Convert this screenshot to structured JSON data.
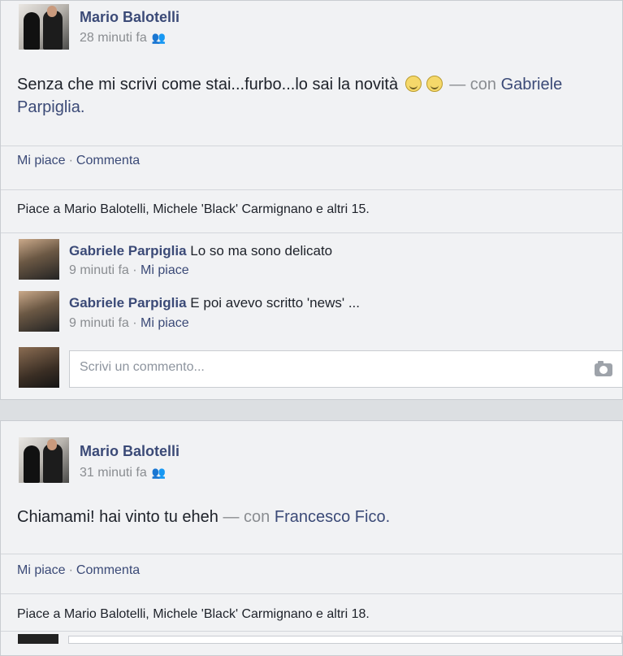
{
  "posts": [
    {
      "author": "Mario Balotelli",
      "time": "28 minuti fa",
      "text_main": "Senza che mi scrivi come stai...furbo...lo sai la novità",
      "text_sep": "— con",
      "tagged": "Gabriele",
      "tagged_cont": "Parpiglia.",
      "actions": {
        "like": "Mi piace",
        "comment": "Commenta"
      },
      "likes_summary": "Piace a Mario Balotelli, Michele 'Black' Carmignano e altri 15.",
      "comments": [
        {
          "author": "Gabriele Parpiglia",
          "text": "Lo so ma sono delicato",
          "time": "9 minuti fa",
          "like": "Mi piace"
        },
        {
          "author": "Gabriele Parpiglia",
          "text": "E poi avevo scritto 'news' ...",
          "time": "9 minuti fa",
          "like": "Mi piace"
        }
      ],
      "comment_placeholder": "Scrivi un commento..."
    },
    {
      "author": "Mario Balotelli",
      "time": "31 minuti fa",
      "text_main": "Chiamami! hai vinto tu eheh",
      "text_sep": "— con",
      "tagged": "Francesco Fico.",
      "actions": {
        "like": "Mi piace",
        "comment": "Commenta"
      },
      "likes_summary": "Piace a Mario Balotelli, Michele 'Black' Carmignano e altri 18."
    }
  ],
  "icons": {
    "audience": "friends-icon",
    "emoji": "smiley-icon",
    "camera": "camera-icon"
  }
}
